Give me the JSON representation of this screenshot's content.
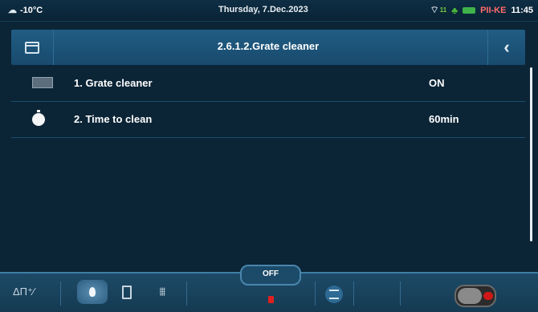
{
  "status": {
    "temperature": "-10°C",
    "date": "Thursday, 7.Dec.2023",
    "wifi_signal": "11",
    "device": "PII-KE",
    "time": "11:45"
  },
  "header": {
    "title": "2.6.1.2.Grate cleaner",
    "back_glyph": "‹"
  },
  "items": [
    {
      "label": "1.  Grate cleaner",
      "value": "ON"
    },
    {
      "label": "2.  Time to clean",
      "value": "60min"
    }
  ],
  "bottom": {
    "mode_icons": "ΔΠ⁺⁄",
    "state_label": "OFF",
    "grid_glyph": "⩩"
  },
  "colors": {
    "background": "#0b2436",
    "accent": "#215d84",
    "stop_red": "#e02020"
  },
  "icons": [
    "cloud-temperature-icon",
    "folder-icon",
    "back-chevron-icon",
    "grate-icon",
    "timer-icon",
    "flame-icon",
    "rectangle-icon",
    "grid-icon",
    "menu-icon",
    "power-toggle-icon"
  ]
}
